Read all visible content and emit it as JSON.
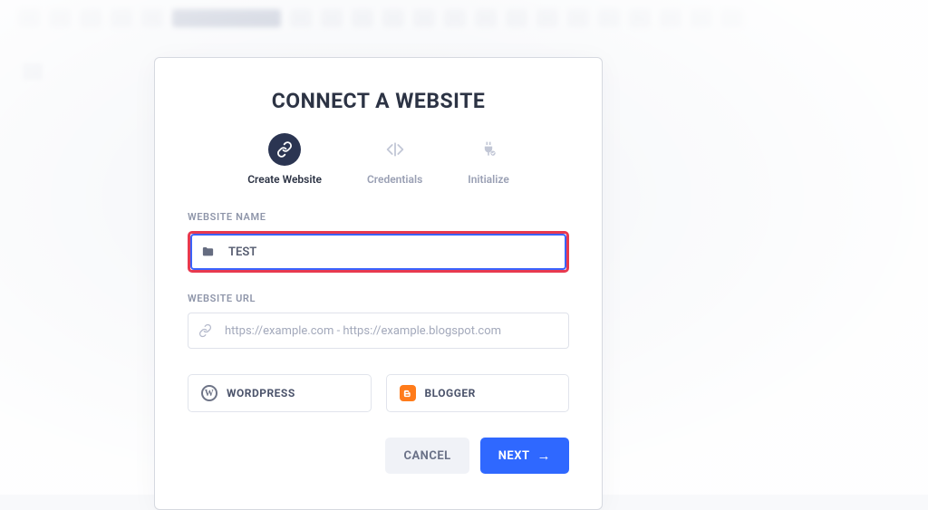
{
  "modal": {
    "title": "CONNECT A WEBSITE",
    "steps": [
      {
        "label": "Create Website",
        "active": true
      },
      {
        "label": "Credentials",
        "active": false
      },
      {
        "label": "Initialize",
        "active": false
      }
    ],
    "fields": {
      "name": {
        "label": "WEBSITE NAME",
        "value": "TEST",
        "placeholder": ""
      },
      "url": {
        "label": "WEBSITE URL",
        "value": "",
        "placeholder": "https://example.com - https://example.blogspot.com"
      }
    },
    "platforms": {
      "wordpress": "WORDPRESS",
      "blogger": "BLOGGER"
    },
    "actions": {
      "cancel": "CANCEL",
      "next": "NEXT"
    }
  }
}
